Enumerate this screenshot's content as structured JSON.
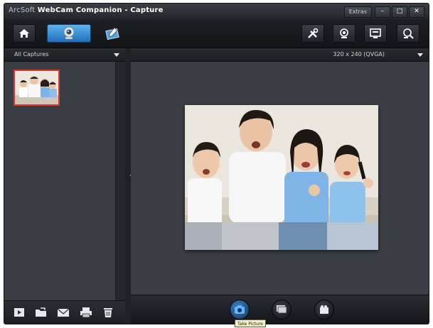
{
  "window": {
    "title_brand": "ArcSoft",
    "title_app": "WebCam Companion",
    "title_sep": " - ",
    "title_mode": "Capture",
    "extras_label": "Extras",
    "min_label": "–",
    "max_label": "□",
    "close_label": "✕"
  },
  "toolbar": {
    "active_tab": "capture",
    "tabs": [
      "home",
      "capture",
      "edit"
    ],
    "right_tools": [
      "settings",
      "face-tracking",
      "monitor",
      "zoom"
    ]
  },
  "left_panel": {
    "filter_label": "All Captures",
    "thumbnail_count": 1
  },
  "right_panel": {
    "resolution_label": "320 x 240 (QVGA)"
  },
  "capture_controls": {
    "tooltip": "Take Picture"
  },
  "colors": {
    "accent": "#2f8fd8",
    "selection": "#d63b2a",
    "panel": "#3b3e44",
    "bar": "#1c1e22"
  }
}
